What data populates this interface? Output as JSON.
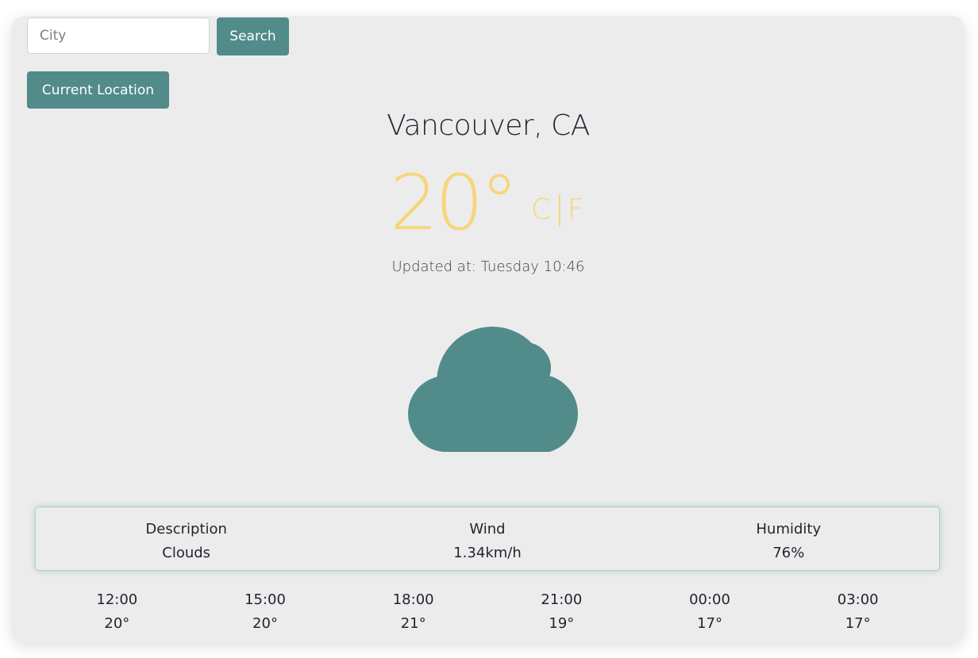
{
  "search": {
    "placeholder": "City",
    "value": "",
    "button_label": "Search"
  },
  "location_button_label": "Current Location",
  "city": "Vancouver, CA",
  "temperature": {
    "value": "20°",
    "unit_c": "C",
    "separator": "|",
    "unit_f": "F"
  },
  "updated_at": "Updated at: Tuesday 10:46",
  "icon": "cloud-icon",
  "details": [
    {
      "label": "Description",
      "value": "Clouds"
    },
    {
      "label": "Wind",
      "value": "1.34km/h"
    },
    {
      "label": "Humidity",
      "value": "76%"
    }
  ],
  "forecast": [
    {
      "time": "12:00",
      "temp": "20°"
    },
    {
      "time": "15:00",
      "temp": "20°"
    },
    {
      "time": "18:00",
      "temp": "21°"
    },
    {
      "time": "21:00",
      "temp": "19°"
    },
    {
      "time": "00:00",
      "temp": "17°"
    },
    {
      "time": "03:00",
      "temp": "17°"
    }
  ],
  "colors": {
    "accent": "#518b8a",
    "temperature": "#f7d57a",
    "background": "#ececec"
  }
}
